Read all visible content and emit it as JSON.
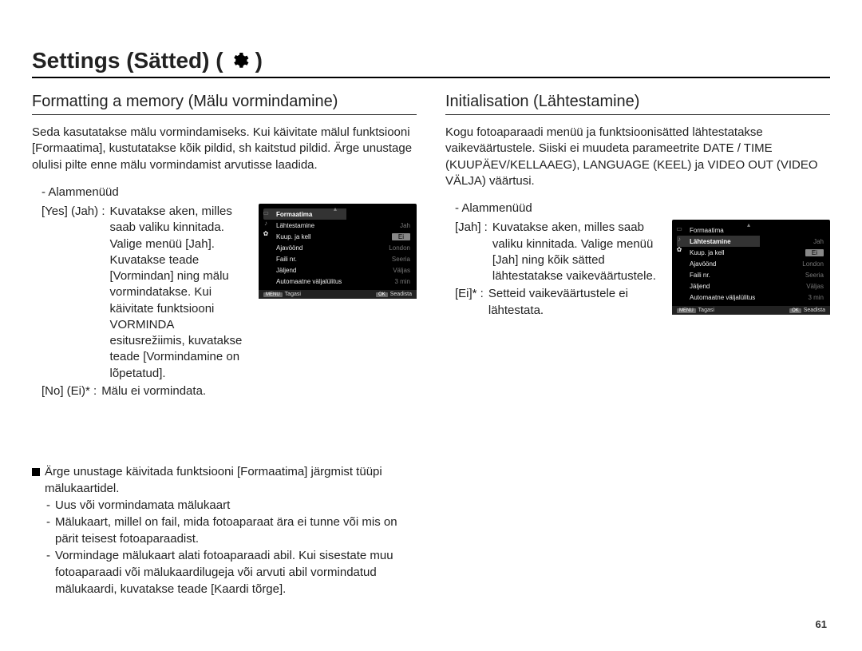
{
  "page": {
    "title": "Settings (Sätted) (",
    "title_close": ")",
    "number": "61"
  },
  "left": {
    "heading": "Formatting a memory (Mälu vormindamine)",
    "intro": "Seda kasutatakse mälu vormindamiseks. Kui käivitate mälul funktsiooni [Formaatima], kustutatakse kõik pildid, sh kaitstud pildid. Ärge unustage olulisi pilte enne mälu vormindamist arvutisse laadida.",
    "submenu_label": "- Alammenüüd",
    "yes_label": "[Yes] (Jah) :",
    "yes_desc": "Kuvatakse aken, milles saab valiku kinnitada. Valige menüü [Jah]. Kuvatakse teade [Vormindan] ning mälu vormindatakse. Kui käivitate funktsiooni VORMINDA esitusrežiimis, kuvatakse teade [Vormindamine on lõpetatud].",
    "no_label": "[No] (Ei)*   :",
    "no_desc": "Mälu ei vormindata.",
    "note_lead": "Ärge unustage käivitada funktsiooni [Formaatima] järgmist tüüpi mälukaartidel.",
    "note_items": [
      "Uus või vormindamata mälukaart",
      "Mälukaart, millel on fail, mida fotoaparaat ära ei tunne või mis on pärit teisest fotoaparaadist.",
      "Vormindage mälukaart alati fotoaparaadi abil. Kui sisestate muu fotoaparaadi või mälukaardilugeja või arvuti abil vormindatud mälukaardi, kuvatakse teade [Kaardi tõrge]."
    ]
  },
  "right": {
    "heading": "Initialisation (Lähtestamine)",
    "intro": "Kogu fotoaparaadi menüü ja funktsioonisätted lähtestatakse vaikeväärtustele. Siiski ei muudeta parameetrite DATE / TIME (KUUPÄEV/KELLAAEG), LANGUAGE (KEEL) ja VIDEO OUT (VIDEO VÄLJA) väärtusi.",
    "submenu_label": "- Alammenüüd",
    "yes_label": "[Jah] :",
    "yes_desc": "Kuvatakse aken, milles saab valiku kinnitada. Valige menüü [Jah] ning kõik sätted lähtestatakse vaikeväärtustele.",
    "no_label": "[Ei]*  :",
    "no_desc": "Setteid vaikeväärtustele ei lähtestata."
  },
  "lcd_common": {
    "items": [
      {
        "l": "Formaatima",
        "r": ""
      },
      {
        "l": "Lähtestamine",
        "r": "Jah"
      },
      {
        "l": "Kuup. ja kell",
        "r": "Ei"
      },
      {
        "l": "Ajavöönd",
        "r": "London"
      },
      {
        "l": "Faili nr.",
        "r": "Seeria"
      },
      {
        "l": "Jäljend",
        "r": "Väljas"
      },
      {
        "l": "Automaatne väljalülitus",
        "r": "3 min"
      }
    ],
    "foot_back_tag": "MENU",
    "foot_back": "Tagasi",
    "foot_set_tag": "OK",
    "foot_set": "Seadista"
  },
  "lcd_left_active_index": 0,
  "lcd_right_active_index": 1
}
